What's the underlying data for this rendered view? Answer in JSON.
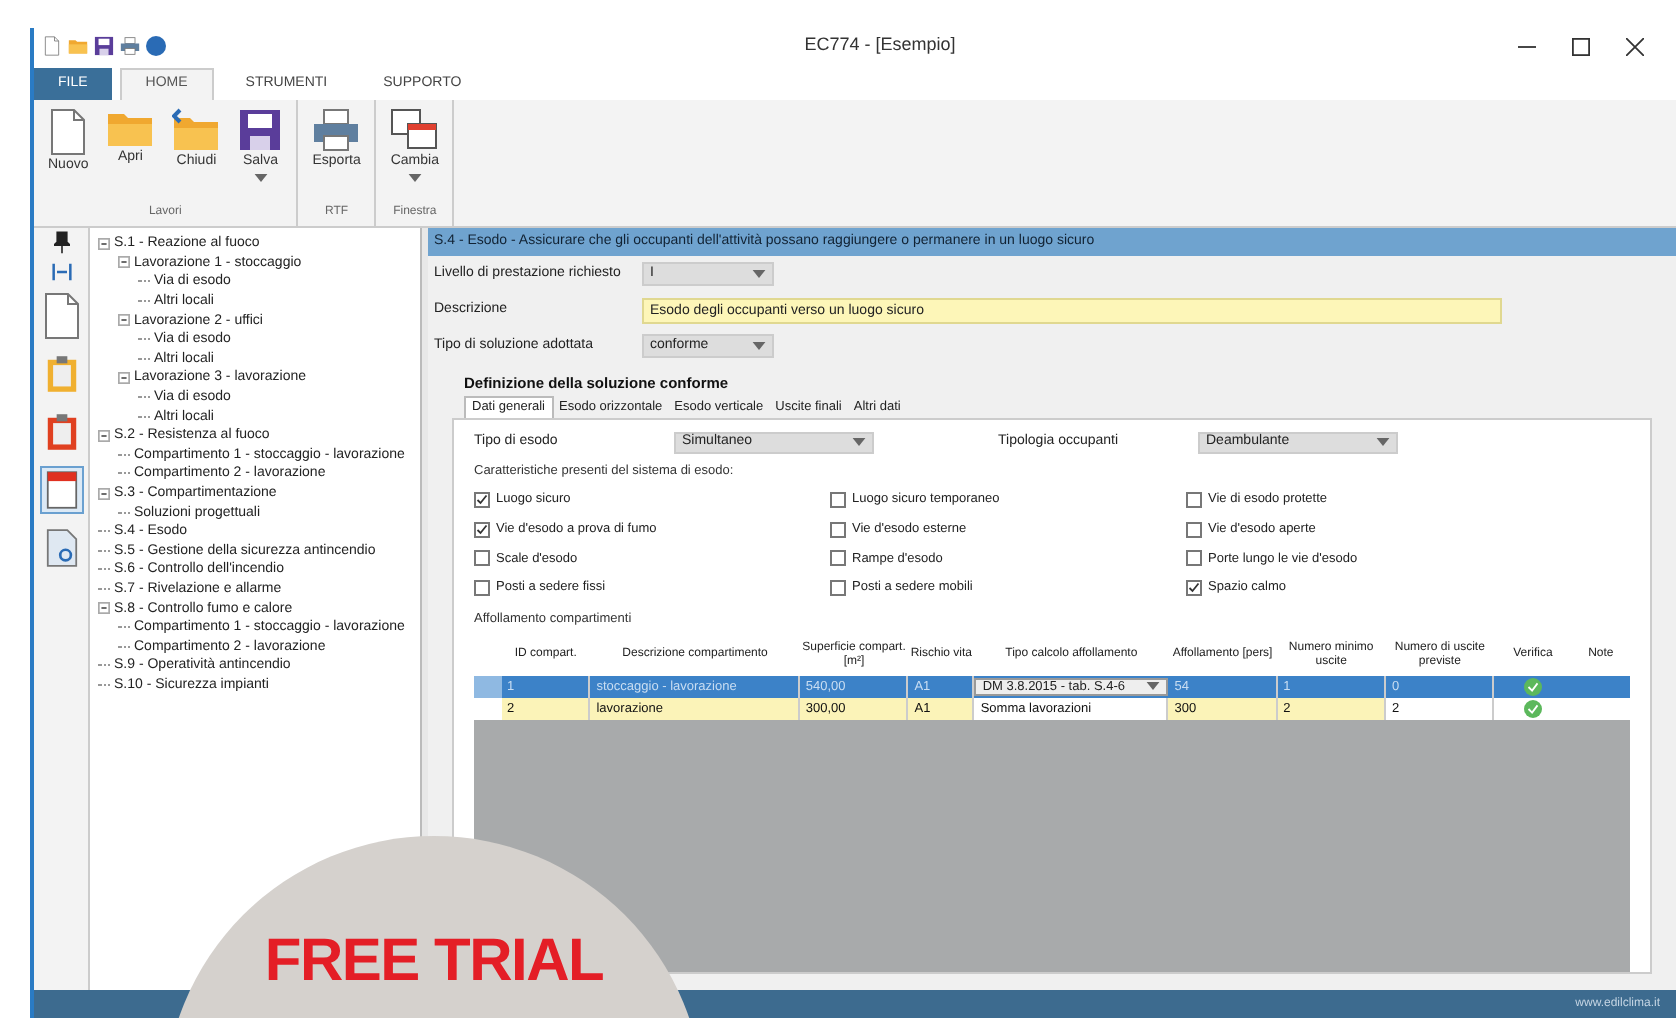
{
  "window": {
    "title": "EC774 - [Esempio]"
  },
  "ribbon": {
    "tabs": [
      {
        "label": "FILE",
        "kind": "file",
        "selected": false
      },
      {
        "label": "HOME",
        "kind": "tab",
        "selected": true
      },
      {
        "label": "STRUMENTI",
        "kind": "tab",
        "selected": false
      },
      {
        "label": "SUPPORTO",
        "kind": "tab",
        "selected": false
      }
    ],
    "groups": [
      {
        "label": "Lavori",
        "buttons": [
          {
            "label": "Nuovo"
          },
          {
            "label": "Apri"
          },
          {
            "label": "Chiudi"
          },
          {
            "label": "Salva"
          }
        ]
      },
      {
        "label": "RTF",
        "buttons": [
          {
            "label": "Esporta"
          }
        ]
      },
      {
        "label": "Finestra",
        "buttons": [
          {
            "label": "Cambia"
          }
        ]
      }
    ]
  },
  "side_toolbar": [
    {
      "selected": false
    },
    {
      "selected": false
    },
    {
      "selected": false
    },
    {
      "selected": false
    },
    {
      "selected": false
    },
    {
      "selected": true
    },
    {
      "selected": false
    }
  ],
  "tree": [
    {
      "label": "S.1 - Reazione al fuoco",
      "children": [
        {
          "label": "Lavorazione 1 - stoccaggio",
          "children": [
            {
              "label": "Via di esodo"
            },
            {
              "label": "Altri locali"
            }
          ]
        },
        {
          "label": "Lavorazione 2 - uffici",
          "children": [
            {
              "label": "Via di esodo"
            },
            {
              "label": "Altri locali"
            }
          ]
        },
        {
          "label": "Lavorazione 3 - lavorazione",
          "children": [
            {
              "label": "Via di esodo"
            },
            {
              "label": "Altri locali"
            }
          ]
        }
      ]
    },
    {
      "label": "S.2 - Resistenza al fuoco",
      "children": [
        {
          "label": "Compartimento 1 - stoccaggio - lavorazione"
        },
        {
          "label": "Compartimento 2 - lavorazione"
        }
      ]
    },
    {
      "label": "S.3 - Compartimentazione",
      "children": [
        {
          "label": "Soluzioni progettuali"
        }
      ]
    },
    {
      "label": "S.4 - Esodo"
    },
    {
      "label": "S.5 - Gestione della sicurezza antincendio"
    },
    {
      "label": "S.6 - Controllo dell'incendio"
    },
    {
      "label": "S.7 - Rivelazione e allarme"
    },
    {
      "label": "S.8 - Controllo fumo e calore",
      "children": [
        {
          "label": "Compartimento 1 - stoccaggio - lavorazione"
        },
        {
          "label": "Compartimento 2 - lavorazione"
        }
      ]
    },
    {
      "label": "S.9 - Operatività antincendio"
    },
    {
      "label": "S.10 - Sicurezza impianti"
    }
  ],
  "panel": {
    "header": "S.4 - Esodo - Assicurare che gli occupanti dell'attività possano raggiungere o permanere in un luogo sicuro",
    "fields": [
      {
        "label": "Livello di prestazione richiesto",
        "kind": "select",
        "value": "I"
      },
      {
        "label": "Descrizione",
        "kind": "text",
        "value": "Esodo degli occupanti verso un luogo sicuro"
      },
      {
        "label": "Tipo di soluzione adottata",
        "kind": "select",
        "value": "conforme"
      }
    ],
    "section_title": "Definizione della soluzione conforme",
    "tabs": [
      {
        "label": "Dati generali",
        "selected": true
      },
      {
        "label": "Esodo orizzontale",
        "selected": false
      },
      {
        "label": "Esodo verticale",
        "selected": false
      },
      {
        "label": "Uscite finali",
        "selected": false
      },
      {
        "label": "Altri dati",
        "selected": false
      }
    ],
    "selects": [
      {
        "label": "Tipo di esodo",
        "value": "Simultaneo"
      },
      {
        "label": "Tipologia occupanti",
        "value": "Deambulante"
      }
    ],
    "features_label": "Caratteristiche presenti del sistema di esodo:",
    "features": [
      {
        "label": "Luogo sicuro",
        "checked": true
      },
      {
        "label": "Luogo sicuro temporaneo",
        "checked": false
      },
      {
        "label": "Vie di esodo protette",
        "checked": false
      },
      {
        "label": "Vie d'esodo a prova di fumo",
        "checked": true
      },
      {
        "label": "Vie d'esodo esterne",
        "checked": false
      },
      {
        "label": "Vie d'esodo aperte",
        "checked": false
      },
      {
        "label": "Scale d'esodo",
        "checked": false
      },
      {
        "label": "Rampe d'esodo",
        "checked": false
      },
      {
        "label": "Porte lungo le vie d'esodo",
        "checked": false
      },
      {
        "label": "Posti a sedere fissi",
        "checked": false
      },
      {
        "label": "Posti a sedere mobili",
        "checked": false
      },
      {
        "label": "Spazio calmo",
        "checked": true
      }
    ],
    "table_label": "Affollamento compartimenti",
    "table": {
      "columns": [
        "ID compart.",
        "Descrizione compartimento",
        "Superficie compart. [m²]",
        "Rischio vita",
        "Tipo calcolo affollamento",
        "Affollamento [pers]",
        "Numero minimo uscite",
        "Numero di uscite previste",
        "Verifica",
        "Note"
      ],
      "rows": [
        {
          "selected": true,
          "verified": true,
          "cells": [
            "1",
            "stoccaggio - lavorazione",
            "540,00",
            "A1",
            "DM 3.8.2015 - tab. S.4-6",
            "54",
            "1",
            "0"
          ]
        },
        {
          "selected": false,
          "verified": true,
          "cells": [
            "2",
            "lavorazione",
            "300,00",
            "A1",
            "Somma lavorazioni",
            "300",
            "2",
            "2"
          ]
        }
      ]
    }
  },
  "status_bar": {
    "text": "www.edilclima.it"
  },
  "promo_badge": {
    "text": "FREE TRIAL"
  }
}
